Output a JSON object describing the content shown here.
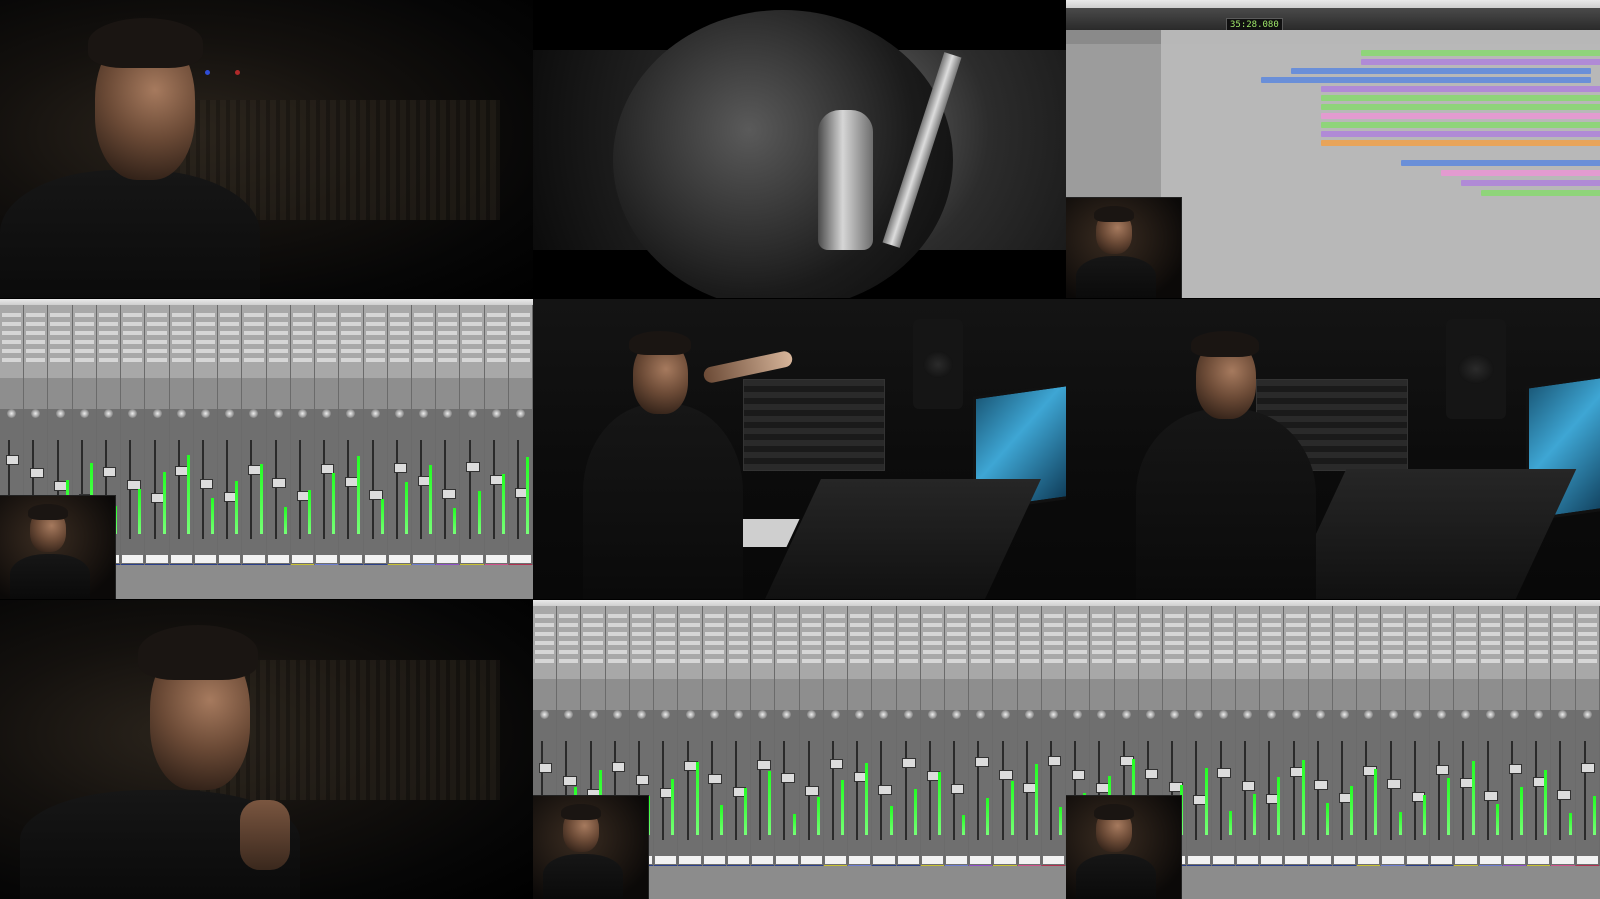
{
  "layout": {
    "rows": 3,
    "cols": 3
  },
  "tiles": [
    {
      "id": "interview-closeup-1",
      "kind": "interview"
    },
    {
      "id": "microphone-bw",
      "kind": "bw-microphone"
    },
    {
      "id": "protools-edit",
      "kind": "edit-window"
    },
    {
      "id": "mixer-1",
      "kind": "mixer"
    },
    {
      "id": "studio-wide-1",
      "kind": "studio"
    },
    {
      "id": "studio-wide-2",
      "kind": "studio"
    },
    {
      "id": "interview-closeup-2",
      "kind": "interview"
    },
    {
      "id": "mixer-2",
      "kind": "mixer"
    },
    {
      "id": "mixer-3",
      "kind": "mixer"
    }
  ],
  "edit_window": {
    "main_counter": "35:28.080",
    "colors": {
      "purple": "#b08ad6",
      "green": "#8fd47a",
      "blue": "#6a8fd8",
      "pink": "#e39bd0",
      "orange": "#e8a45a"
    }
  },
  "mixer": {
    "strip_count": 22,
    "color_stripes": [
      "#2a3f8a",
      "#2a3f8a",
      "#2a3f8a",
      "#2a3f8a",
      "#2a3f8a",
      "#2a3f8a",
      "#2a3f8a",
      "#2a3f8a",
      "#2a3f8a",
      "#2a3f8a",
      "#2a3f8a",
      "#2a3f8a",
      "#c7c030",
      "#6a7bd0",
      "#2a3f8a",
      "#2a3f8a",
      "#c7c030",
      "#6a7bd0",
      "#8f4fc9",
      "#c7c030",
      "#d0508a",
      "#b03050"
    ]
  }
}
